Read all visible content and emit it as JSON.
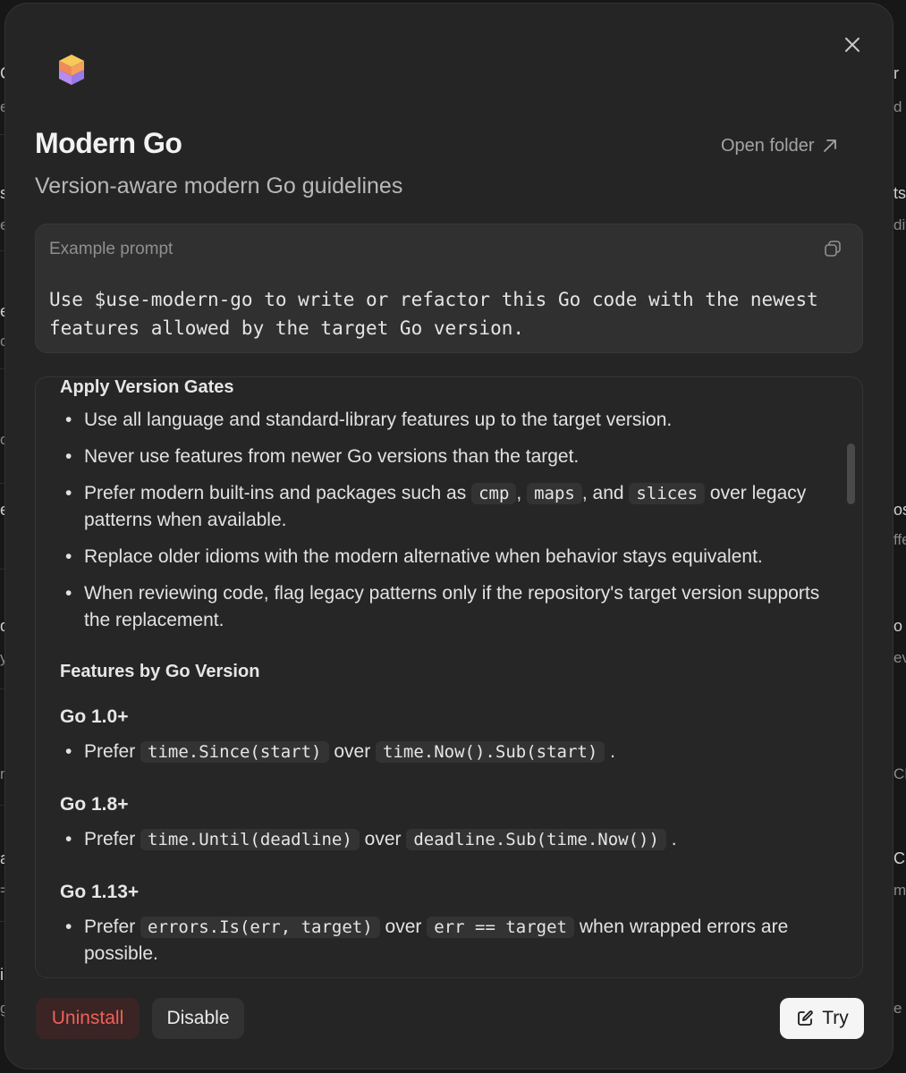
{
  "background": {
    "left_items": [
      "C",
      "e",
      "s",
      "e",
      "e",
      "o",
      "c",
      "e",
      "d",
      "d",
      "y",
      "n",
      "a",
      "=",
      "i",
      "g"
    ],
    "right_items": [
      "r",
      "d s",
      "ts",
      "dit",
      "os",
      "ffe",
      "o",
      "ev",
      "CF",
      "C",
      "me",
      "e"
    ]
  },
  "modal": {
    "title": "Modern Go",
    "subtitle": "Version-aware modern Go guidelines",
    "open_folder_label": "Open folder",
    "example_prompt": {
      "label": "Example prompt",
      "text": "Use $use-modern-go to write or refactor this Go code with the newest features allowed by the target Go version."
    },
    "content": {
      "section1_title": "Apply Version Gates",
      "section1_bullets": {
        "b1": "Use all language and standard-library features up to the target version.",
        "b2": "Never use features from newer Go versions than the target.",
        "b3_pre": "Prefer modern built-ins and packages such as",
        "b3_code1": "cmp",
        "b3_code2": "maps",
        "b3_mid": ", and",
        "b3_code3": "slices",
        "b3_post": "over legacy patterns when available.",
        "b4": "Replace older idioms with the modern alternative when behavior stays equivalent.",
        "b5": "When reviewing code, flag legacy patterns only if the repository's target version supports the replacement."
      },
      "section2_title": "Features by Go Version",
      "versions": [
        {
          "heading": "Go 1.0+",
          "prefix": "Prefer",
          "code_new": "time.Since(start)",
          "over": "over",
          "code_old": "time.Now().Sub(start)",
          "suffix": "."
        },
        {
          "heading": "Go 1.8+",
          "prefix": "Prefer",
          "code_new": "time.Until(deadline)",
          "over": "over",
          "code_old": "deadline.Sub(time.Now())",
          "suffix": "."
        },
        {
          "heading": "Go 1.13+",
          "prefix": "Prefer",
          "code_new": "errors.Is(err, target)",
          "over": "over",
          "code_old": "err == target",
          "suffix": "when wrapped errors are possible."
        }
      ]
    },
    "buttons": {
      "uninstall": "Uninstall",
      "disable": "Disable",
      "try": "Try"
    }
  },
  "colors": {
    "danger": "#f0605a",
    "modal_bg": "#252525",
    "code_bg": "#333333"
  },
  "icons": [
    "close-icon",
    "app-logo-icon",
    "external-link-icon",
    "copy-icon",
    "edit-icon"
  ]
}
